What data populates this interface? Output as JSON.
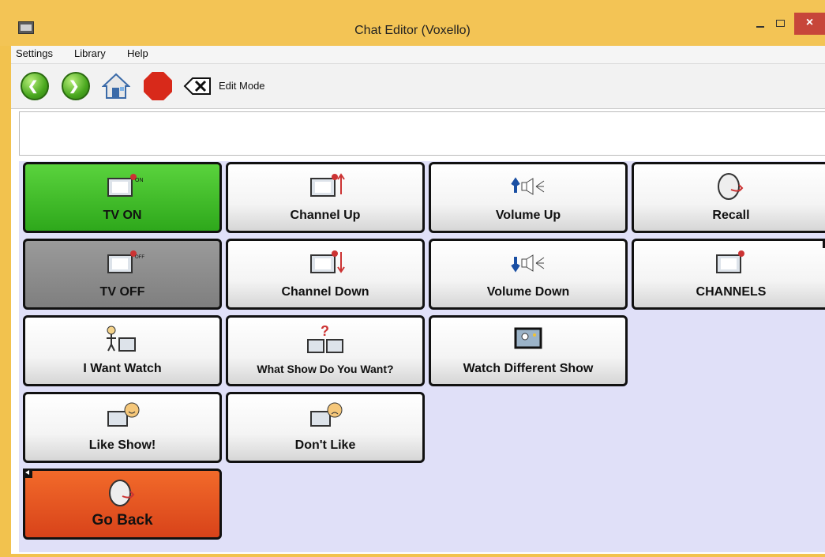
{
  "window": {
    "title": "Chat Editor (Voxello)",
    "close_glyph": "×"
  },
  "menu": [
    "Settings",
    "Library",
    "Help"
  ],
  "toolbar": {
    "edit_mode": "Edit Mode",
    "back_icon": "back-arrow-icon",
    "forward_icon": "forward-arrow-icon",
    "home_icon": "home-icon",
    "stop_icon": "stop-icon",
    "clear_icon": "clear-icon"
  },
  "message_box": {
    "value": ""
  },
  "buttons": [
    {
      "label": "TV ON",
      "icon": "tv-on-icon",
      "style": "green",
      "color": "#2ea81b"
    },
    {
      "label": "Channel Up",
      "icon": "channel-up-icon",
      "style": "white"
    },
    {
      "label": "Volume Up",
      "icon": "volume-up-icon",
      "style": "white"
    },
    {
      "label": "Recall",
      "icon": "recall-icon",
      "style": "white"
    },
    {
      "label": "TV OFF",
      "icon": "tv-off-icon",
      "style": "gray",
      "color": "#8a8a8a"
    },
    {
      "label": "Channel Down",
      "icon": "channel-down-icon",
      "style": "white"
    },
    {
      "label": "Volume Down",
      "icon": "volume-down-icon",
      "style": "white"
    },
    {
      "label": "CHANNELS",
      "icon": "channels-icon",
      "style": "white"
    },
    {
      "label": "I Want Watch",
      "icon": "want-watch-icon",
      "style": "white"
    },
    {
      "label": "What Show Do You Want?",
      "icon": "question-show-icon",
      "style": "white"
    },
    {
      "label": "Watch Different Show",
      "icon": "different-show-icon",
      "style": "white"
    },
    {
      "label": "Like Show!",
      "icon": "like-show-icon",
      "style": "white"
    },
    {
      "label": "Don't Like",
      "icon": "dont-like-icon",
      "style": "white"
    },
    {
      "label": "Go Back",
      "icon": "go-back-icon",
      "style": "red",
      "color": "#e0501f"
    }
  ]
}
